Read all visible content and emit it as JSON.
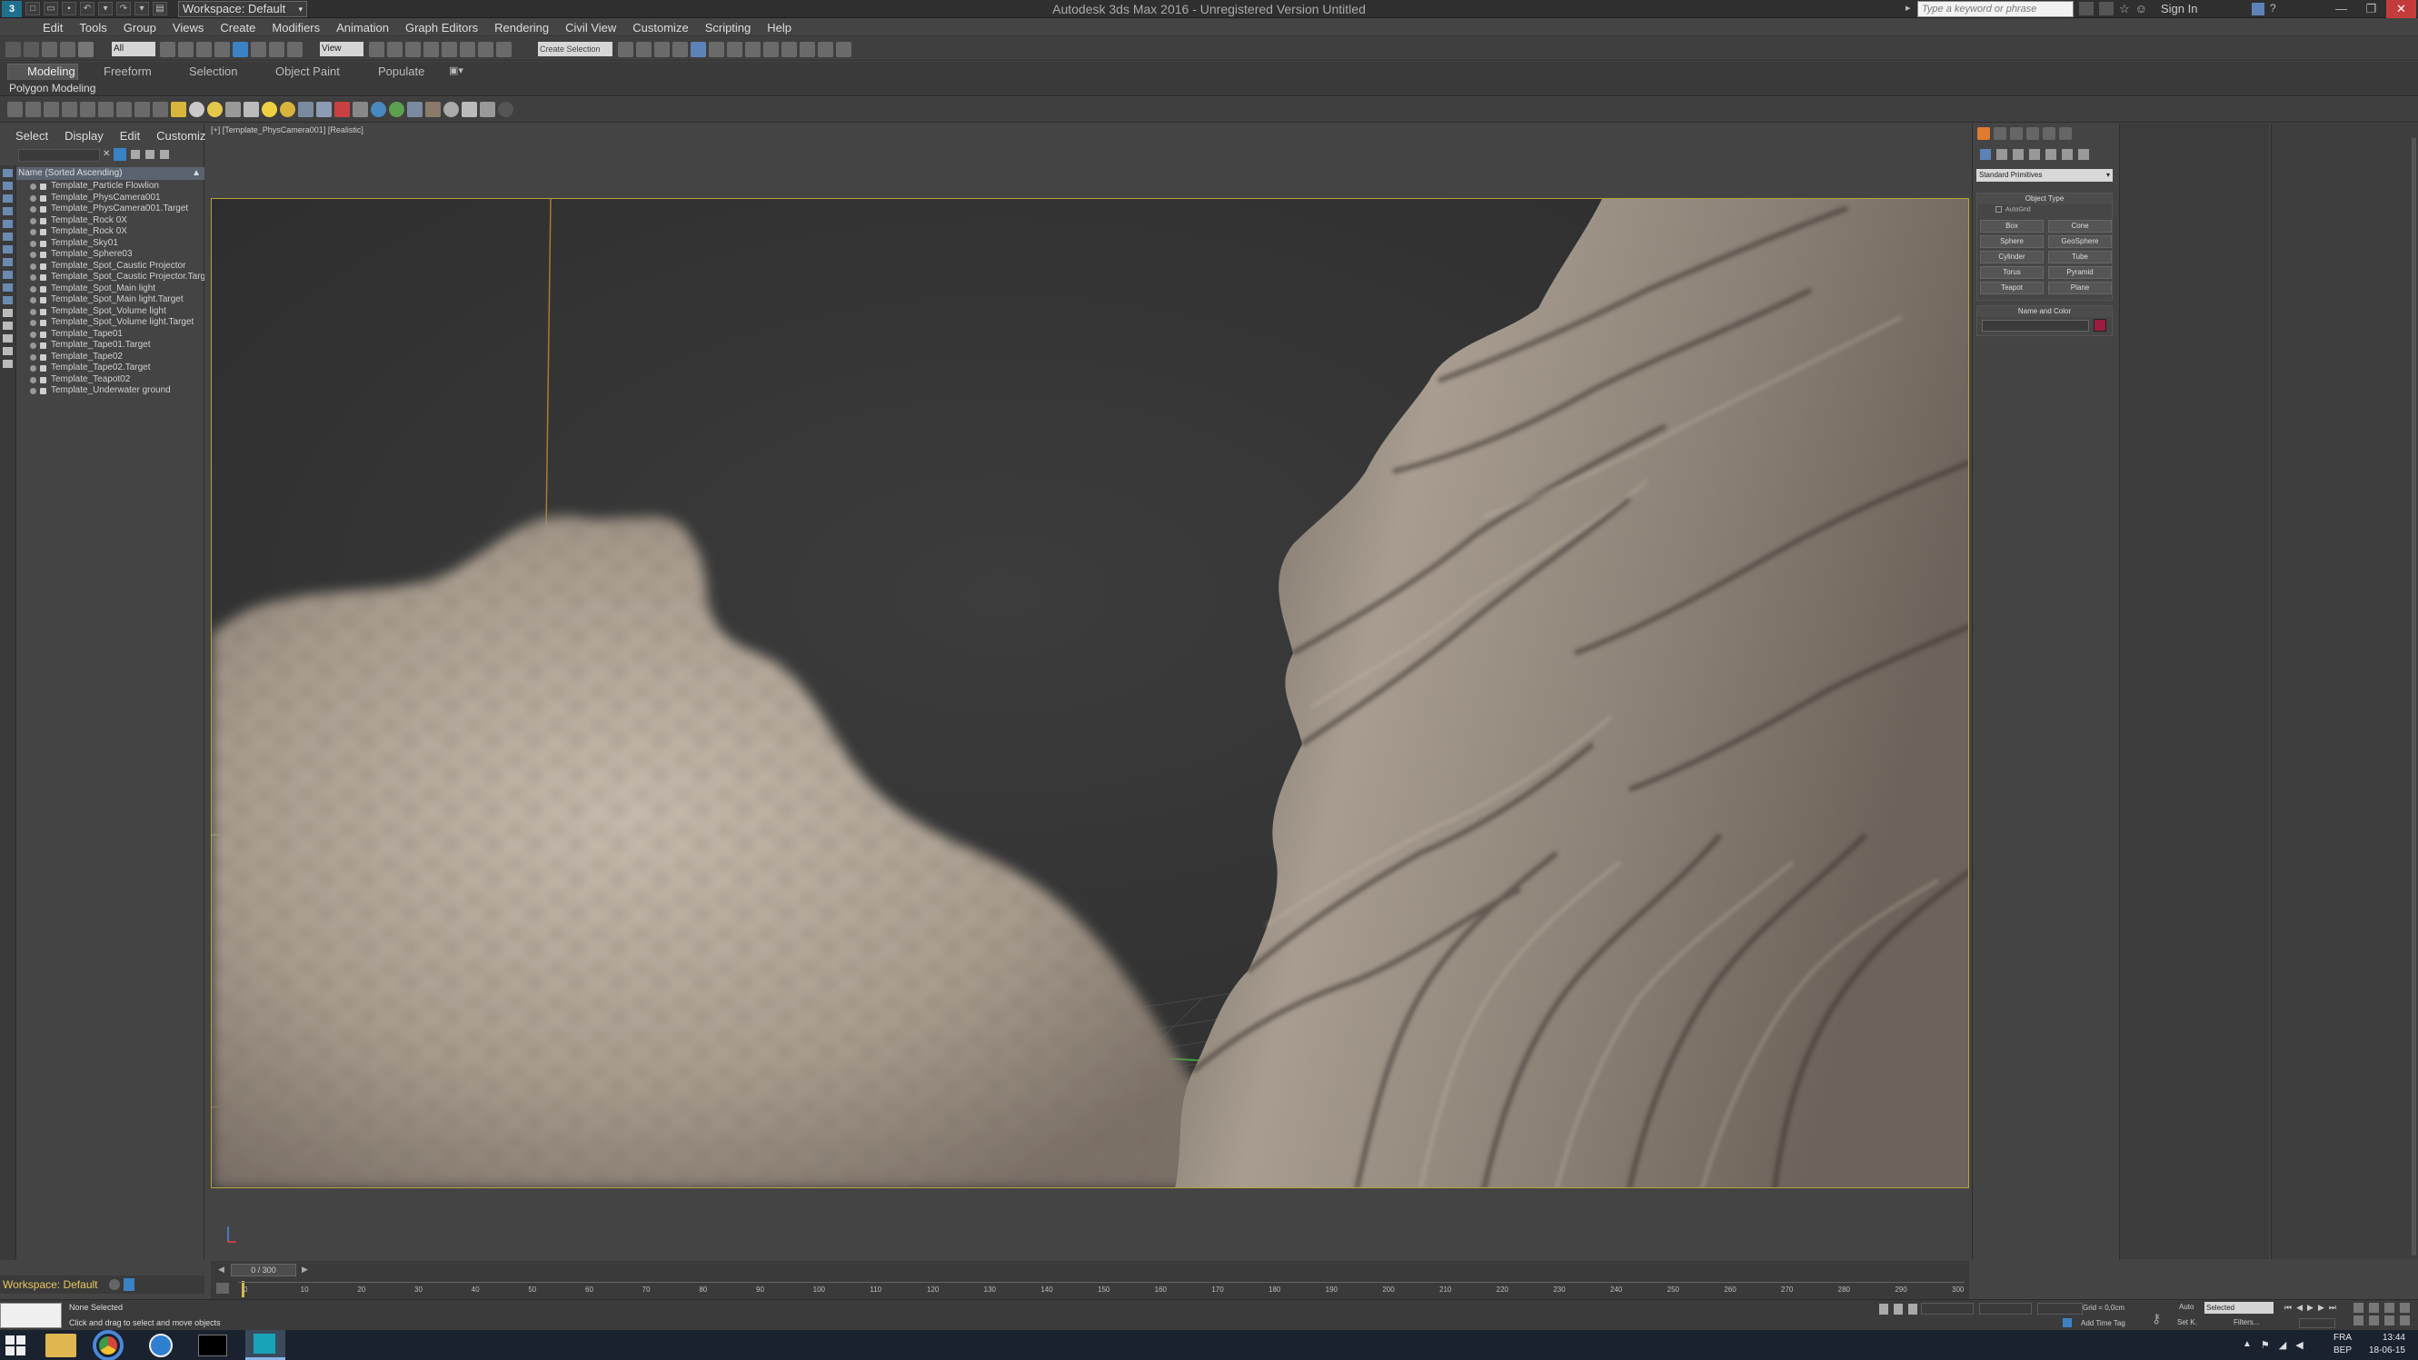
{
  "title_bar": {
    "workspace_select": "Workspace: Default",
    "app_title": "Autodesk 3ds Max 2016 - Unregistered Version    Untitled",
    "search_placeholder": "Type a keyword or phrase",
    "sign_in": "Sign In"
  },
  "menu": [
    "Edit",
    "Tools",
    "Group",
    "Views",
    "Create",
    "Modifiers",
    "Animation",
    "Graph Editors",
    "Rendering",
    "Civil View",
    "Customize",
    "Scripting",
    "Help"
  ],
  "toolbar": {
    "selection_filter": "All",
    "ref_coord": "View",
    "named_selection": "Create Selection Se"
  },
  "ribbon": {
    "tabs": [
      "Modeling",
      "Freeform",
      "Selection",
      "Object Paint",
      "Populate"
    ],
    "active_tab": "Modeling",
    "sub_label": "Polygon Modeling"
  },
  "scene_explorer": {
    "tabs": [
      "Select",
      "Display",
      "Edit",
      "Customize"
    ],
    "column_header": "Name (Sorted Ascending)",
    "items": [
      "Template_Particle Flowlion",
      "Template_PhysCamera001",
      "Template_PhysCamera001.Target",
      "Template_Rock 0X",
      "Template_Rock 0X",
      "Template_Sky01",
      "Template_Sphere03",
      "Template_Spot_Caustic Projector",
      "Template_Spot_Caustic Projector.Target",
      "Template_Spot_Main light",
      "Template_Spot_Main light.Target",
      "Template_Spot_Volume light",
      "Template_Spot_Volume light.Target",
      "Template_Tape01",
      "Template_Tape01.Target",
      "Template_Tape02",
      "Template_Tape02.Target",
      "Template_Teapot02",
      "Template_Underwater ground"
    ],
    "workspace_label": "Workspace: Default"
  },
  "viewport": {
    "label": "[+] [Template_PhysCamera001] [Realistic]"
  },
  "command_panel": {
    "dropdown": "Standard Primitives",
    "object_type_title": "Object Type",
    "autogrid": "AutoGrid",
    "primitives": [
      "Box",
      "Cone",
      "Sphere",
      "GeoSphere",
      "Cylinder",
      "Tube",
      "Torus",
      "Pyramid",
      "Teapot",
      "Plane"
    ],
    "name_color_title": "Name and Color",
    "object_color": "#9b1c3c"
  },
  "timeline": {
    "frame_counter": "0 / 300",
    "ticks": [
      "0",
      "10",
      "20",
      "30",
      "40",
      "50",
      "60",
      "70",
      "80",
      "90",
      "100",
      "110",
      "120",
      "130",
      "140",
      "150",
      "160",
      "170",
      "180",
      "190",
      "200",
      "210",
      "220",
      "230",
      "240",
      "250",
      "260",
      "270",
      "280",
      "290",
      "300"
    ]
  },
  "status_bar": {
    "selection_status": "None Selected",
    "prompt": "Click and drag to select and move objects",
    "grid": "Grid = 0,0cm",
    "auto_key": "Auto",
    "set_key": "Set K.",
    "selected_dropdown": "Selected",
    "filters": "Filters...",
    "add_time_tag": "Add Time Tag"
  },
  "taskbar": {
    "lang": "FRA",
    "kb": "BEP",
    "time": "13:44",
    "date": "18-06-15"
  }
}
